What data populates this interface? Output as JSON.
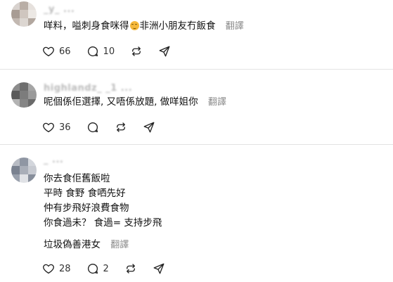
{
  "posts": [
    {
      "username": "_y_ ...",
      "lines": [
        "咩料，嗌刺身食咪得",
        "非洲小朋友冇飯食"
      ],
      "translate": "翻譯",
      "likes": "66",
      "comments": "10",
      "avatar_colors": [
        "#d8d2ce",
        "#b9aea6",
        "#e6e1dd",
        "#a89c94",
        "#cfc6bf",
        "#ece8e4",
        "#c2b8b1",
        "#dcd6d1",
        "#b2a79f"
      ]
    },
    {
      "username": "highlandz_ _1 ...",
      "lines": [
        "呢個係佢選擇, 又唔係放題, 做咩姐你"
      ],
      "translate": "翻譯",
      "likes": "36",
      "comments": "",
      "avatar_colors": [
        "#8c8c8c",
        "#6e6e6e",
        "#a5a5a5",
        "#595959",
        "#7c7c7c",
        "#9a9a9a",
        "#b3b3b3",
        "#858585",
        "#6a6a6a"
      ]
    },
    {
      "username": "_ ... ",
      "lines": [
        "你去食佢舊飯啦",
        "平時 食野 食哂先好",
        "仲有步飛好浪費食物",
        "你食過未？ 食過= 支持步飛",
        "垃圾偽善港女"
      ],
      "translate": "翻譯",
      "likes": "28",
      "comments": "2",
      "avatar_colors": [
        "#b8bcc4",
        "#8f96a3",
        "#d3d6dc",
        "#7a8290",
        "#a9aeb8",
        "#c7cad1",
        "#9aa1ad",
        "#e0e2e6",
        "#878e9b"
      ]
    }
  ],
  "icons": [
    "heart-icon",
    "comment-icon",
    "repost-icon",
    "share-icon"
  ]
}
